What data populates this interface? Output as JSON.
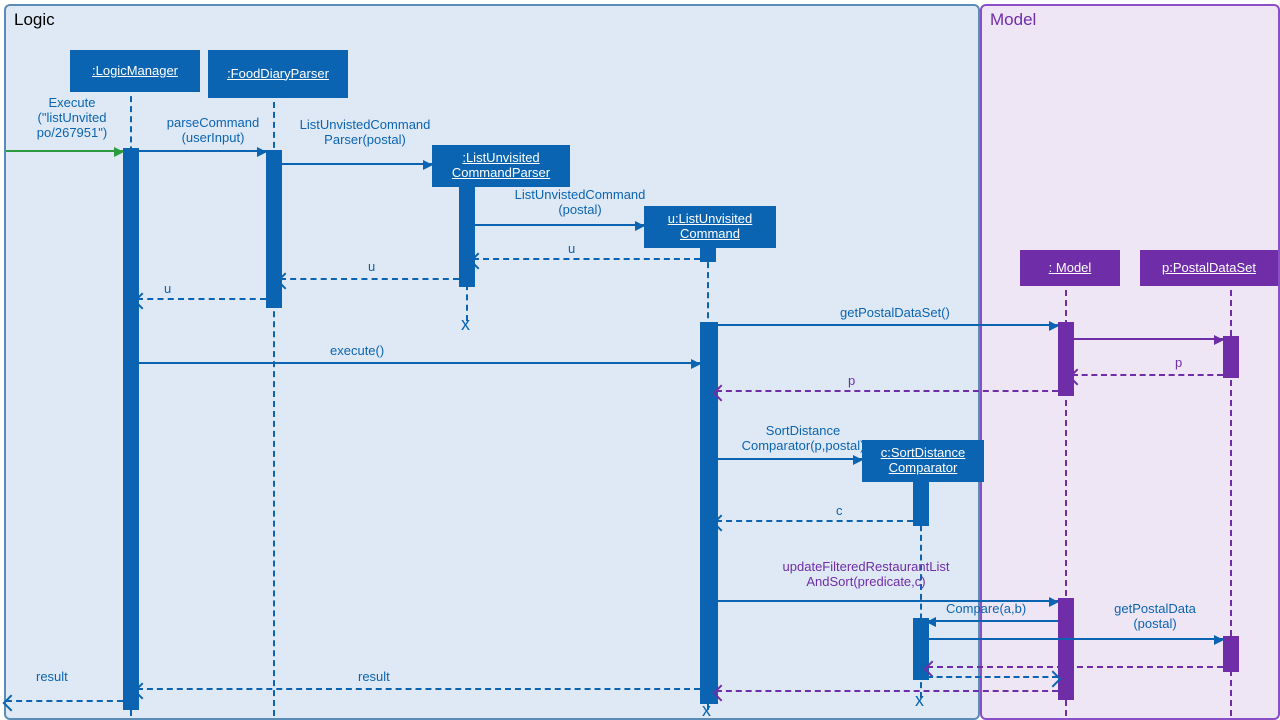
{
  "regions": {
    "logic": "Logic",
    "model": "Model"
  },
  "lifelines": {
    "lm": ":LogicManager",
    "fdp": ":FoodDiaryParser",
    "lucp": ":ListUnvisited\nCommandParser",
    "luc": "u:ListUnvisited\nCommand",
    "sdc": "c:SortDistance\nComparator",
    "mdl": ": Model",
    "pds": "p:PostalDataSet"
  },
  "messages": {
    "exec_in": "Execute\n(\"listUnvited\npo/267951\")",
    "parseCmd": "parseCommand\n(userInput)",
    "newLucp": "ListUnvistedCommand\nParser(postal)",
    "newLuc": "ListUnvistedCommand\n(postal)",
    "ret_u1": "u",
    "ret_u2": "u",
    "ret_u3": "u",
    "execute": "execute()",
    "getPDS": "getPostalDataSet()",
    "ret_p1": "p",
    "ret_p2": "p",
    "newSDC": "SortDistance\nComparator(p,postal)",
    "ret_c": "c",
    "update": "updateFilteredRestaurantList\nAndSort(predicate,c)",
    "compare": "Compare(a,b)",
    "getPD": "getPostalData\n(postal)",
    "result1": "result",
    "result2": "result"
  },
  "colors": {
    "blue": "#0b64b2",
    "purple": "#6f2da8",
    "green": "#2e9a3f",
    "logicBg": "#dfe9f5",
    "modelBg": "#efe6f5"
  },
  "chart_data": {
    "type": "sequence-diagram",
    "regions": [
      {
        "name": "Logic",
        "color": "#5b8cb7"
      },
      {
        "name": "Model",
        "color": "#8a4fc7"
      }
    ],
    "lifelines": [
      {
        "id": "lm",
        "label": ":LogicManager",
        "region": "Logic"
      },
      {
        "id": "fdp",
        "label": ":FoodDiaryParser",
        "region": "Logic"
      },
      {
        "id": "lucp",
        "label": ":ListUnvisitedCommandParser",
        "region": "Logic",
        "created_by": "fdp",
        "destroyed": true
      },
      {
        "id": "luc",
        "label": "u:ListUnvisitedCommand",
        "region": "Logic",
        "created_by": "lucp",
        "destroyed": true
      },
      {
        "id": "sdc",
        "label": "c:SortDistanceComparator",
        "region": "Logic",
        "created_by": "luc",
        "destroyed": true
      },
      {
        "id": "mdl",
        "label": ": Model",
        "region": "Model"
      },
      {
        "id": "pds",
        "label": "p:PostalDataSet",
        "region": "Model"
      }
    ],
    "messages": [
      {
        "from": "<external>",
        "to": "lm",
        "label": "Execute(\"listUnvited po/267951\")",
        "kind": "sync"
      },
      {
        "from": "lm",
        "to": "fdp",
        "label": "parseCommand(userInput)",
        "kind": "sync"
      },
      {
        "from": "fdp",
        "to": "lucp",
        "label": "ListUnvistedCommandParser(postal)",
        "kind": "create"
      },
      {
        "from": "lucp",
        "to": "luc",
        "label": "ListUnvistedCommand(postal)",
        "kind": "create"
      },
      {
        "from": "luc",
        "to": "lucp",
        "label": "u",
        "kind": "return"
      },
      {
        "from": "lucp",
        "to": "fdp",
        "label": "u",
        "kind": "return"
      },
      {
        "from": "fdp",
        "to": "lm",
        "label": "u",
        "kind": "return"
      },
      {
        "from": "lm",
        "to": "luc",
        "label": "execute()",
        "kind": "sync"
      },
      {
        "from": "luc",
        "to": "mdl",
        "label": "getPostalDataSet()",
        "kind": "sync"
      },
      {
        "from": "mdl",
        "to": "pds",
        "label": "",
        "kind": "sync"
      },
      {
        "from": "pds",
        "to": "mdl",
        "label": "p",
        "kind": "return"
      },
      {
        "from": "mdl",
        "to": "luc",
        "label": "p",
        "kind": "return"
      },
      {
        "from": "luc",
        "to": "sdc",
        "label": "SortDistanceComparator(p,postal)",
        "kind": "create"
      },
      {
        "from": "sdc",
        "to": "luc",
        "label": "c",
        "kind": "return"
      },
      {
        "from": "luc",
        "to": "mdl",
        "label": "updateFilteredRestaurantListAndSort(predicate,c)",
        "kind": "sync"
      },
      {
        "from": "mdl",
        "to": "sdc",
        "label": "Compare(a,b)",
        "kind": "sync"
      },
      {
        "from": "sdc",
        "to": "pds",
        "label": "getPostalData(postal)",
        "kind": "sync"
      },
      {
        "from": "pds",
        "to": "sdc",
        "label": "",
        "kind": "return"
      },
      {
        "from": "sdc",
        "to": "mdl",
        "label": "",
        "kind": "return"
      },
      {
        "from": "mdl",
        "to": "luc",
        "label": "",
        "kind": "return"
      },
      {
        "from": "luc",
        "to": "lm",
        "label": "result",
        "kind": "return"
      },
      {
        "from": "lm",
        "to": "<external>",
        "label": "result",
        "kind": "return"
      }
    ]
  }
}
